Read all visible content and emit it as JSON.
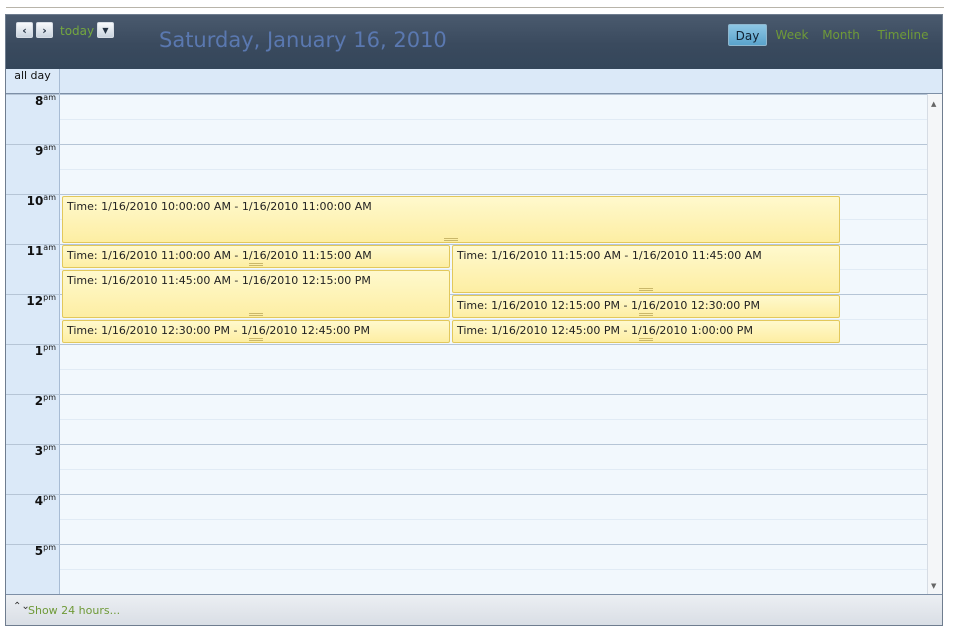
{
  "toolbar": {
    "prev_icon": "‹",
    "next_icon": "›",
    "today_label": "today",
    "dropdown_icon": "▼",
    "date_title": "Saturday, January 16, 2010",
    "views": [
      {
        "label": "Day",
        "active": true
      },
      {
        "label": "Week",
        "active": false
      },
      {
        "label": "Month",
        "active": false
      },
      {
        "label": "Timeline",
        "active": false
      }
    ]
  },
  "allday": {
    "label": "all day"
  },
  "hours": [
    {
      "hour": "8",
      "suffix": "am"
    },
    {
      "hour": "9",
      "suffix": "am"
    },
    {
      "hour": "10",
      "suffix": "am"
    },
    {
      "hour": "11",
      "suffix": "am"
    },
    {
      "hour": "12",
      "suffix": "pm"
    },
    {
      "hour": "1",
      "suffix": "pm"
    },
    {
      "hour": "2",
      "suffix": "pm"
    },
    {
      "hour": "3",
      "suffix": "pm"
    },
    {
      "hour": "4",
      "suffix": "pm"
    },
    {
      "hour": "5",
      "suffix": "pm"
    }
  ],
  "appointments": [
    {
      "text": "Time: 1/16/2010 10:00:00 AM - 1/16/2010 11:00:00 AM"
    },
    {
      "text": "Time: 1/16/2010 11:00:00 AM - 1/16/2010 11:15:00 AM"
    },
    {
      "text": "Time: 1/16/2010 11:15:00 AM - 1/16/2010 11:45:00 AM"
    },
    {
      "text": "Time: 1/16/2010 11:45:00 AM - 1/16/2010 12:15:00 PM"
    },
    {
      "text": "Time: 1/16/2010 12:15:00 PM - 1/16/2010 12:30:00 PM"
    },
    {
      "text": "Time: 1/16/2010 12:30:00 PM - 1/16/2010 12:45:00 PM"
    },
    {
      "text": "Time: 1/16/2010 12:45:00 PM - 1/16/2010 1:00:00 PM"
    }
  ],
  "scrollbar": {
    "up_icon": "▲",
    "down_icon": "▼"
  },
  "footer": {
    "icon": "⌃⌄",
    "link_label": "Show 24 hours..."
  },
  "colors": {
    "toolbar": "#3a4a5e",
    "accent_green": "#6f9a38",
    "date_title": "#5a78b0",
    "appointment_fill": "#fdeea3",
    "appointment_border": "#e2c85c",
    "active_view": "#5aa3cc"
  }
}
